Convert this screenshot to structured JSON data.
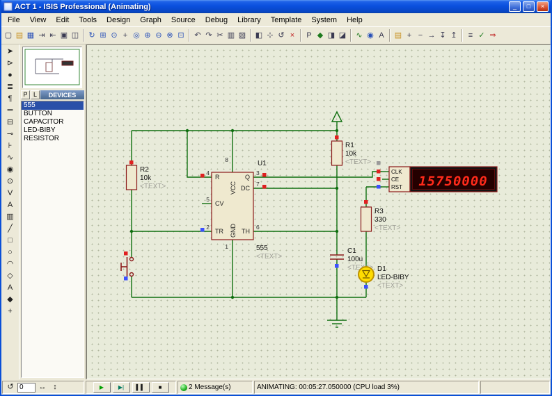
{
  "window": {
    "title": "ACT 1 - ISIS Professional (Animating)",
    "controls": {
      "minimize": "_",
      "maximize": "□",
      "close": "×"
    }
  },
  "menubar": {
    "items": [
      "File",
      "View",
      "Edit",
      "Tools",
      "Design",
      "Graph",
      "Source",
      "Debug",
      "Library",
      "Template",
      "System",
      "Help"
    ]
  },
  "toolbar": {
    "icons": [
      {
        "name": "new-file",
        "glyph": "▢"
      },
      {
        "name": "open-file",
        "glyph": "▤"
      },
      {
        "name": "save-file",
        "glyph": "▦"
      },
      {
        "name": "import-section",
        "glyph": "⇥"
      },
      {
        "name": "export-section",
        "glyph": "⇤"
      },
      {
        "name": "print",
        "glyph": "▣"
      },
      {
        "name": "mark-output-area",
        "glyph": "◫"
      },
      {
        "name": "redraw",
        "glyph": "↻"
      },
      {
        "name": "toggle-grid",
        "glyph": "⊞"
      },
      {
        "name": "origin",
        "glyph": "⊙"
      },
      {
        "name": "x-cursor",
        "glyph": "+"
      },
      {
        "name": "pan",
        "glyph": "◎"
      },
      {
        "name": "zoom-in",
        "glyph": "⊕"
      },
      {
        "name": "zoom-out",
        "glyph": "⊖"
      },
      {
        "name": "zoom-all",
        "glyph": "⊗"
      },
      {
        "name": "zoom-area",
        "glyph": "⊡"
      },
      {
        "name": "undo",
        "glyph": "↶"
      },
      {
        "name": "redo",
        "glyph": "↷"
      },
      {
        "name": "cut",
        "glyph": "✂"
      },
      {
        "name": "copy",
        "glyph": "▥"
      },
      {
        "name": "paste",
        "glyph": "▨"
      },
      {
        "name": "block-copy",
        "glyph": "◧"
      },
      {
        "name": "block-move",
        "glyph": "⊹"
      },
      {
        "name": "block-rotate",
        "glyph": "↺"
      },
      {
        "name": "block-delete",
        "glyph": "×"
      },
      {
        "name": "pick-parts",
        "glyph": "P"
      },
      {
        "name": "make-device",
        "glyph": "◆"
      },
      {
        "name": "packaging-tool",
        "glyph": "◨"
      },
      {
        "name": "decompose",
        "glyph": "◪"
      },
      {
        "name": "wire-autorouter",
        "glyph": "∿"
      },
      {
        "name": "search-tag",
        "glyph": "◉"
      },
      {
        "name": "property-assignment",
        "glyph": "A"
      },
      {
        "name": "design-explorer",
        "glyph": "▤"
      },
      {
        "name": "new-sheet",
        "glyph": "+"
      },
      {
        "name": "remove-sheet",
        "glyph": "−"
      },
      {
        "name": "goto-sheet",
        "glyph": "→"
      },
      {
        "name": "zoom-to-child",
        "glyph": "↧"
      },
      {
        "name": "return-to-parent",
        "glyph": "↥"
      },
      {
        "name": "bill-of-materials",
        "glyph": "≡"
      },
      {
        "name": "electrical-rule-check",
        "glyph": "✓"
      },
      {
        "name": "netlist-to-ares",
        "glyph": "⇒"
      }
    ]
  },
  "toolbox": {
    "icons": [
      {
        "name": "selection-mode",
        "glyph": "➤"
      },
      {
        "name": "component-mode",
        "glyph": "⊳"
      },
      {
        "name": "junction-dot-mode",
        "glyph": "●"
      },
      {
        "name": "wire-label-mode",
        "glyph": "≣"
      },
      {
        "name": "text-script-mode",
        "glyph": "¶"
      },
      {
        "name": "bus-mode",
        "glyph": "═"
      },
      {
        "name": "subcircuit-mode",
        "glyph": "⊟"
      },
      {
        "name": "terminal-mode",
        "glyph": "⊸"
      },
      {
        "name": "device-pin-mode",
        "glyph": "⊦"
      },
      {
        "name": "graph-mode",
        "glyph": "∿"
      },
      {
        "name": "tape-recorder-mode",
        "glyph": "◉"
      },
      {
        "name": "generator-mode",
        "glyph": "⊙"
      },
      {
        "name": "voltage-probe-mode",
        "glyph": "V"
      },
      {
        "name": "current-probe-mode",
        "glyph": "A"
      },
      {
        "name": "virtual-instrument-mode",
        "glyph": "▥"
      },
      {
        "name": "2d-line-mode",
        "glyph": "╱"
      },
      {
        "name": "2d-box-mode",
        "glyph": "□"
      },
      {
        "name": "2d-circle-mode",
        "glyph": "○"
      },
      {
        "name": "2d-arc-mode",
        "glyph": "◠"
      },
      {
        "name": "2d-path-mode",
        "glyph": "◇"
      },
      {
        "name": "2d-text-mode",
        "glyph": "A"
      },
      {
        "name": "2d-symbol-mode",
        "glyph": "◆"
      },
      {
        "name": "2d-marker-mode",
        "glyph": "+"
      }
    ]
  },
  "object_selector": {
    "pick_label": "P",
    "library_label": "L",
    "header": "DEVICES",
    "devices": [
      "555",
      "BUTTON",
      "CAPACITOR",
      "LED-BIBY",
      "RESISTOR"
    ],
    "selected_device": "555"
  },
  "orientation": {
    "rotate_glyph": "↺",
    "angle": "0",
    "h_mirror_glyph": "↔",
    "v_mirror_glyph": "↕"
  },
  "simulation": {
    "play_glyph": "▶",
    "step_glyph": "▶|",
    "pause_glyph": "▌▌",
    "stop_glyph": "■"
  },
  "statusbar": {
    "message_count": "2 Message(s)",
    "status": "ANIMATING: 00:05:27.050000 (CPU load 3%)"
  },
  "circuit": {
    "components": {
      "r1": {
        "ref": "R1",
        "value": "10k",
        "text": "<TEXT>"
      },
      "r2": {
        "ref": "R2",
        "value": "10k",
        "text": "<TEXT>"
      },
      "r3": {
        "ref": "R3",
        "value": "330",
        "text": "<TEXT>"
      },
      "c1": {
        "ref": "C1",
        "value": "100u",
        "text": "<TEXT>"
      },
      "d1": {
        "ref": "D1",
        "value": "LED-BIBY",
        "text": "<TEXT>"
      },
      "u1": {
        "ref": "U1",
        "value": "555",
        "text": "<TEXT>"
      }
    },
    "u1_pins": {
      "left": [
        {
          "num": "4",
          "name": "R"
        },
        {
          "num": "5",
          "name": "CV"
        },
        {
          "num": "2",
          "name": "TR"
        }
      ],
      "right": [
        {
          "num": "3",
          "name": "Q"
        },
        {
          "num": "7",
          "name": "DC"
        },
        {
          "num": "6",
          "name": "TH"
        }
      ],
      "top": {
        "num": "8",
        "name": "VCC"
      },
      "bottom": {
        "num": "1",
        "name": "GND"
      }
    },
    "display": {
      "value": "15750000",
      "pins": [
        "CLK",
        "CE",
        "RST"
      ]
    },
    "colors": {
      "wire": "#0E6E0E",
      "component_outline": "#8B1A1A",
      "state_high": "#E02020",
      "state_low": "#3C50FF",
      "led_body": "#FFDC00",
      "segment_red": "#FF2A1A"
    }
  }
}
